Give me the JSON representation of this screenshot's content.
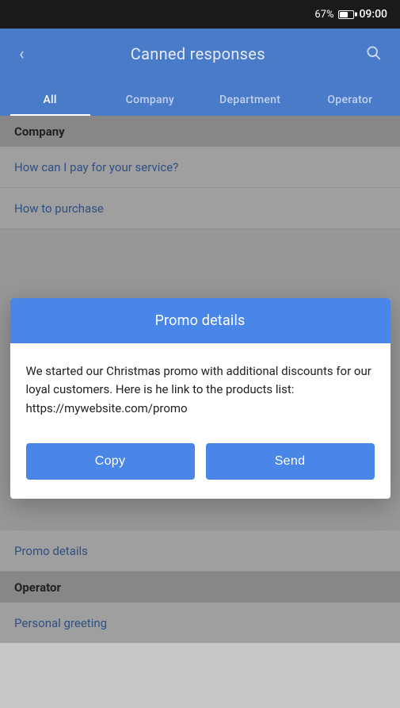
{
  "statusBar": {
    "battery": "67%",
    "time": "09:00"
  },
  "appBar": {
    "title": "Canned responses",
    "backLabel": "‹",
    "searchIcon": "search"
  },
  "tabs": [
    {
      "label": "All",
      "active": true
    },
    {
      "label": "Company",
      "active": false
    },
    {
      "label": "Department",
      "active": false
    },
    {
      "label": "Operator",
      "active": false
    }
  ],
  "sections": [
    {
      "header": "Company",
      "items": [
        "How can I pay for your service?",
        "How to purchase"
      ]
    }
  ],
  "modal": {
    "title": "Promo details",
    "body": "We started our Christmas promo with additional discounts for our loyal customers. Here is he link to the products list: https://mywebsite.com/promo",
    "copyLabel": "Copy",
    "sendLabel": "Send"
  },
  "bottomSections": [
    {
      "listItem": "Promo details"
    }
  ],
  "operatorSection": {
    "header": "Operator",
    "items": [
      "Personal greeting"
    ]
  }
}
